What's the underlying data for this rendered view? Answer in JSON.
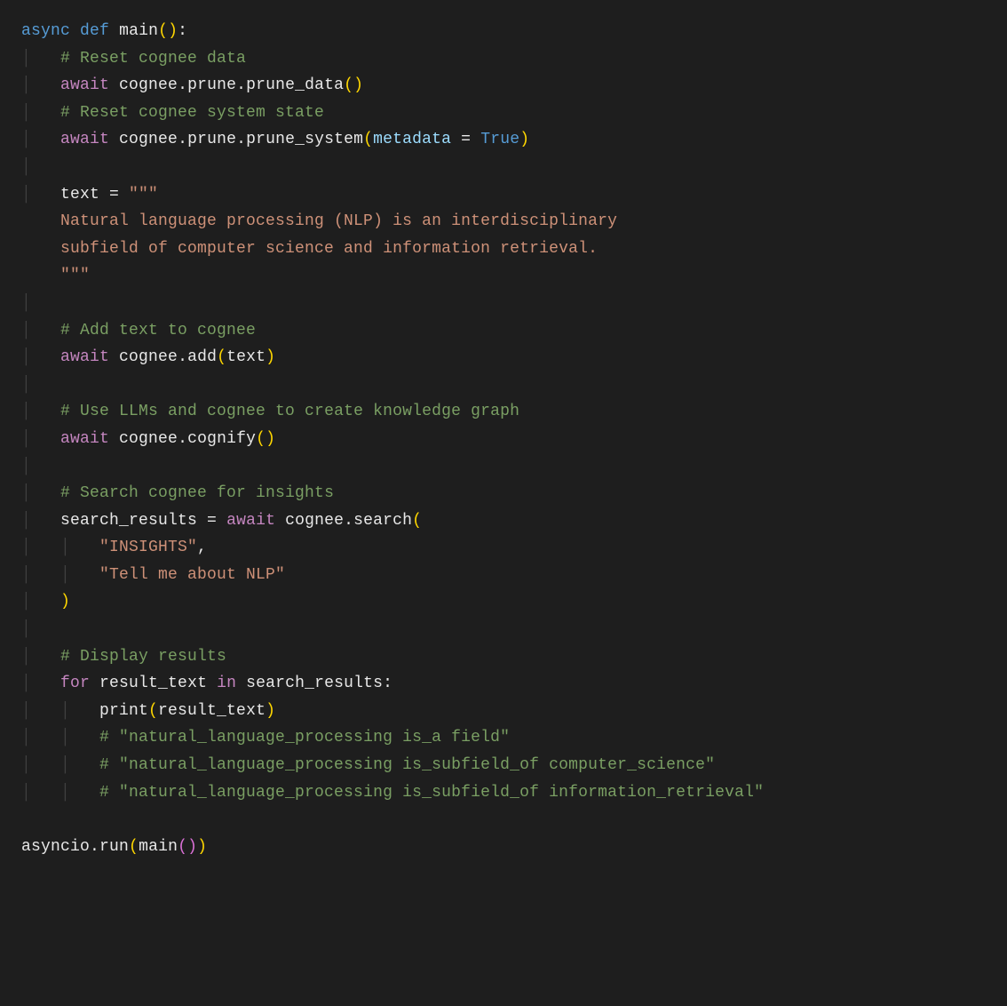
{
  "code": {
    "line1": {
      "async": "async",
      "def": "def",
      "name": "main",
      "lparen": "(",
      "rparen": ")",
      "colon": ":"
    },
    "line2": {
      "comment": "# Reset cognee data"
    },
    "line3": {
      "await": "await",
      "obj": "cognee",
      "m1": "prune",
      "m2": "prune_data",
      "lp": "(",
      "rp": ")"
    },
    "line4": {
      "comment": "# Reset cognee system state"
    },
    "line5": {
      "await": "await",
      "obj": "cognee",
      "m1": "prune",
      "m2": "prune_system",
      "lp": "(",
      "param": "metadata",
      "eq": " = ",
      "val": "True",
      "rp": ")"
    },
    "line7": {
      "var": "text",
      "eq": " = ",
      "quotes": "\"\"\""
    },
    "line8": {
      "str": "    Natural language processing (NLP) is an interdisciplinary"
    },
    "line9": {
      "str": "    subfield of computer science and information retrieval."
    },
    "line10": {
      "quotes": "    \"\"\""
    },
    "line12": {
      "comment": "# Add text to cognee"
    },
    "line13": {
      "await": "await",
      "obj": "cognee",
      "m1": "add",
      "lp": "(",
      "arg": "text",
      "rp": ")"
    },
    "line15": {
      "comment": "# Use LLMs and cognee to create knowledge graph"
    },
    "line16": {
      "await": "await",
      "obj": "cognee",
      "m1": "cognify",
      "lp": "(",
      "rp": ")"
    },
    "line18": {
      "comment": "# Search cognee for insights"
    },
    "line19": {
      "var": "search_results",
      "eq": " = ",
      "await": "await",
      "obj": "cognee",
      "m1": "search",
      "lp": "("
    },
    "line20": {
      "str": "\"INSIGHTS\"",
      "comma": ","
    },
    "line21": {
      "str": "\"Tell me about NLP\""
    },
    "line22": {
      "rp": ")"
    },
    "line24": {
      "comment": "# Display results"
    },
    "line25": {
      "for": "for",
      "var": "result_text",
      "in": "in",
      "iter": "search_results",
      "colon": ":"
    },
    "line26": {
      "fn": "print",
      "lp": "(",
      "arg": "result_text",
      "rp": ")"
    },
    "line27": {
      "comment": "# \"natural_language_processing is_a field\""
    },
    "line28": {
      "comment": "# \"natural_language_processing is_subfield_of computer_science\""
    },
    "line29": {
      "comment": "# \"natural_language_processing is_subfield_of information_retrieval\""
    },
    "line31": {
      "obj": "asyncio",
      "m1": "run",
      "lp": "(",
      "fn": "main",
      "lp2": "(",
      "rp2": ")",
      "rp": ")"
    }
  }
}
